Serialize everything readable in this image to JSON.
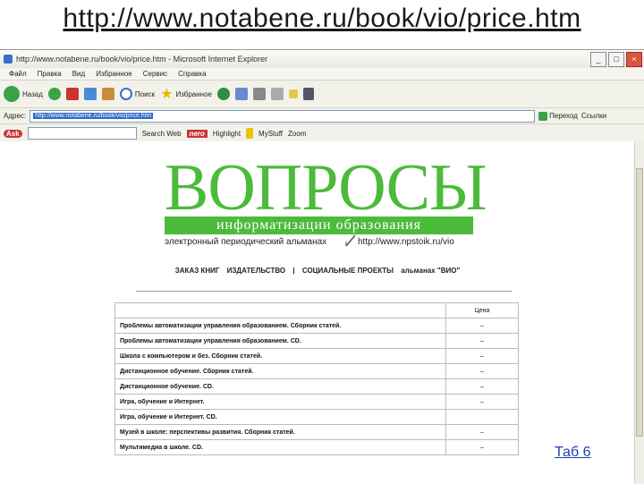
{
  "slide": {
    "title": "http://www.notabene.ru/book/vio/price.htm",
    "footer_link": "Таб 6"
  },
  "browser": {
    "window_title": "http://www.notabene.ru/book/vio/price.htm - Microsoft Internet Explorer",
    "menu": [
      "Файл",
      "Правка",
      "Вид",
      "Избранное",
      "Сервис",
      "Справка"
    ],
    "toolbar": {
      "back": "Назад",
      "search": "Поиск",
      "favorites": "Избранное"
    },
    "address": {
      "label": "Адрес:",
      "value": "http://www.notabene.ru/book/vio/price.htm",
      "go": "Переход",
      "links": "Ссылки"
    },
    "linksbar": {
      "ask": "Ask",
      "search": "Search Web",
      "highlight": "Highlight",
      "mystuff": "MyStuff",
      "zoom": "Zoom",
      "nero": "nero"
    }
  },
  "page": {
    "logo": {
      "title": "ВОПРОСЫ",
      "band": "информатизации образования",
      "subtitle": "электронный периодический альманах",
      "url": "http://www.npstoik.ru/vio"
    },
    "nav": [
      "ЗАКАЗ КНИГ",
      "ИЗДАТЕЛЬСТВО",
      "|",
      "СОЦИАЛЬНЫЕ ПРОЕКТЫ",
      "альманах \"ВИО\""
    ],
    "table": {
      "header_price": "Цена",
      "rows": [
        {
          "name": "Проблемы автоматизации управления образованием. Сборник статей.",
          "price": "–"
        },
        {
          "name": "Проблемы автоматизации управления образованием. CD.",
          "price": "–"
        },
        {
          "name": "Школа с компьютером и без. Сборник статей.",
          "price": "–"
        },
        {
          "name": "Дистанционное обучение. Сборник статей.",
          "price": "–"
        },
        {
          "name": "Дистанционное обучение. CD.",
          "price": "–"
        },
        {
          "name": "Игра, обучение и Интернет.",
          "price": "–"
        },
        {
          "name": "Игра, обучение и Интернет. CD.",
          "price": ""
        },
        {
          "name": "Музей в школе: перспективы развития. Сборник статей.",
          "price": "–"
        },
        {
          "name": "Мультимедиа в школе. CD.",
          "price": "–"
        }
      ]
    }
  },
  "colors": {
    "logo_green": "#4cba3b",
    "link_blue": "#1f3fa8"
  }
}
